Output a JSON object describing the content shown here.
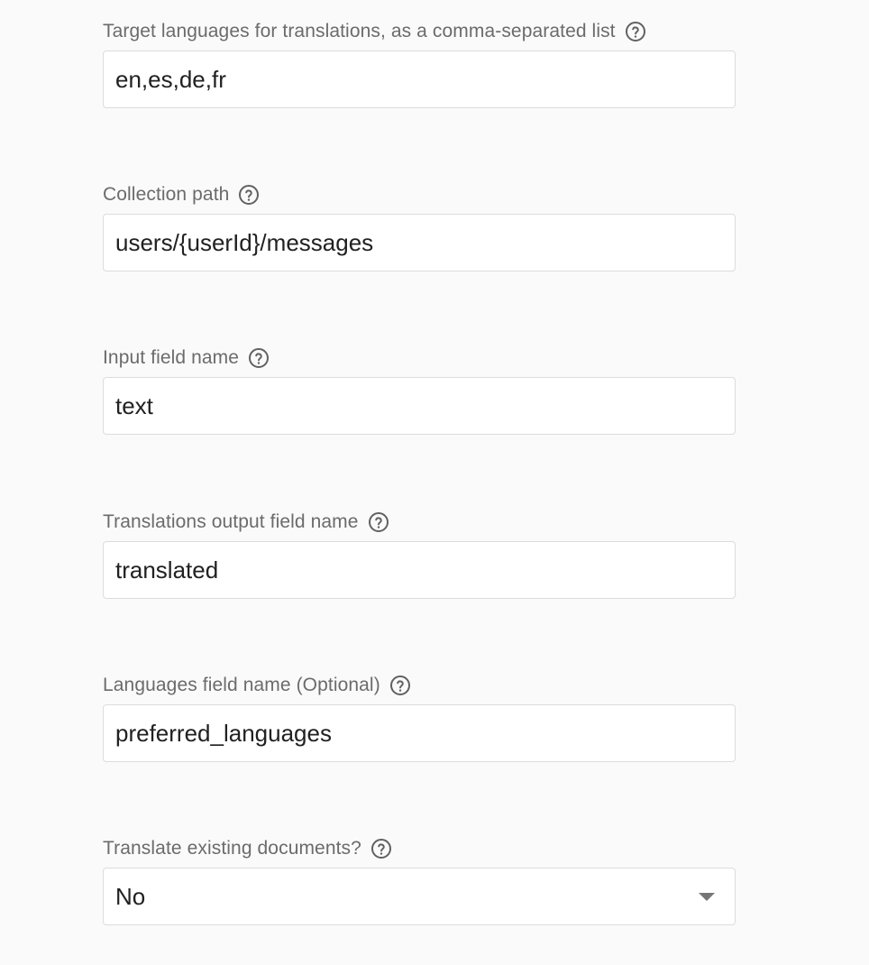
{
  "fields": [
    {
      "label": "Target languages for translations, as a comma-separated list",
      "help_icon": "help-circle-icon",
      "type": "text",
      "value": "en,es,de,fr"
    },
    {
      "label": "Collection path",
      "help_icon": "help-circle-icon",
      "type": "text",
      "value": "users/{userId}/messages"
    },
    {
      "label": "Input field name",
      "help_icon": "help-circle-icon",
      "type": "text",
      "value": "text"
    },
    {
      "label": "Translations output field name",
      "help_icon": "help-circle-icon",
      "type": "text",
      "value": "translated"
    },
    {
      "label": "Languages field name (Optional)",
      "help_icon": "help-circle-icon",
      "type": "text",
      "value": "preferred_languages"
    },
    {
      "label": "Translate existing documents?",
      "help_icon": "help-circle-icon",
      "type": "select",
      "value": "No",
      "caret_icon": "dropdown-caret-icon"
    }
  ],
  "colors": {
    "background": "#fafafa",
    "label": "#6b6b6b",
    "input_text": "#212121",
    "border": "#dcdcdc",
    "icon": "#616161"
  }
}
